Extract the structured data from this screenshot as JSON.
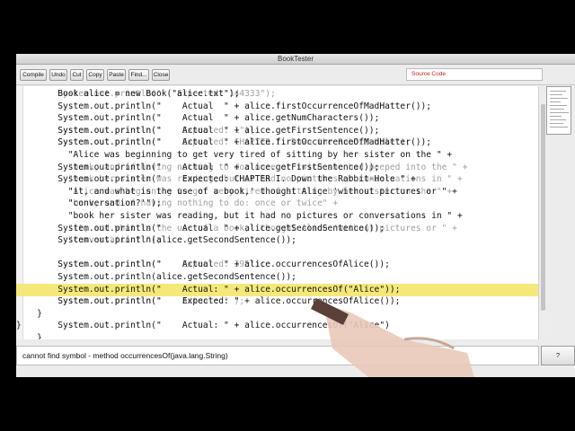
{
  "window": {
    "title": "BookTester"
  },
  "toolbar": {
    "buttons": [
      "Compile",
      "Undo",
      "Cut",
      "Copy",
      "Paste",
      "Find...",
      "Close"
    ],
    "view": "Source Code"
  },
  "code": {
    "lines": [
      {
        "text": "        Book alice = new Book(\"alice.txt\");",
        "ghost": "        System.out.println(\"   Expected: 144333\");"
      },
      {
        "text": "        System.out.println(\"    Actual  \" + alice.firstOccurrenceOfMadHatter());",
        "ghost": ""
      },
      {
        "text": "        System.out.println(\"    Actual  \" + alice.getNumCharacters());",
        "ghost": ""
      },
      {
        "text": "        System.out.println(\"    Actual  \" + alice.getFirstSentence());",
        "ghost": "        System.out.println(\"    Expected: 1\");"
      },
      {
        "text": "        System.out.println(\"    Actual  \" + alice.firstOccurrenceOfMadHatter());",
        "ghost": "        System.out.println(\"    Expected: CHAPTER I. Down the Rabbit-Hole\");"
      },
      {
        "text": "          \"Alice was beginning to get very tired of sitting by her sister on the \" +",
        "ghost": ""
      },
      {
        "text": "        System.out.println(\"    Actual  \" + alice.getFirstSentence());",
        "ghost": "          \"bank, and of having nothing to do: once or twice she had peeped into the \" +"
      },
      {
        "text": "        System.out.println(\"    Expected: CHAPTER I. Down the Rabbit-Hole \" +",
        "ghost": "          \"book her sister was reading, but it had no pictures or conversations in \" +"
      },
      {
        "text": "          \"it, and what is the use of a book,' thought Alice 'without pictures or \" +",
        "ghost": "          \"Alice was beginning to get very tired of sitting by her sister on the \" +"
      },
      {
        "text": "          \"conversation?'\");",
        "ghost": "          \"bank, and of having nothing to do: once or twice\" +"
      },
      {
        "text": "          \"book her sister was reading, but it had no pictures or conversations in \" +",
        "ghost": ""
      },
      {
        "text": "        System.out.println(\"    Actual  \" + alice.getSecondSentence());",
        "ghost": "          \"it, and what is the use of a book,' thought Alice 'without pictures or \" +"
      },
      {
        "text": "        System.out.println(alice.getSecondSentence());",
        "ghost": "          \"conversation?'\");"
      },
      {
        "text": "",
        "ghost": ""
      },
      {
        "text": "        System.out.println(\"    Actual  \" + alice.occurrencesOfAlice());",
        "ghost": "        System.out.println(\"    Expected: 395\");"
      },
      {
        "text": "        System.out.println(alice.getSecondSentence());",
        "ghost": ""
      },
      {
        "text": "        System.out.println(\"    Actual: \" + alice.occurrencesOf(\"Alice\"));",
        "ghost": ""
      },
      {
        "text": "        System.out.println(\"    Expected: \" + alice.occurrencesOfAlice());",
        "ghost": "        System.out.println(\"    Actual: \" );"
      },
      {
        "text": "    }",
        "ghost": ""
      },
      {
        "text": "}       System.out.println(\"    Actual: \" + alice.occurrencesOf(\"Alice\")",
        "ghost": ""
      },
      {
        "text": "    }",
        "ghost": ""
      }
    ]
  },
  "message": "cannot find symbol -   method occurrencesOf(java.lang.String)",
  "message_button": "?",
  "colors": {
    "highlight": "#f5e87a",
    "error": "#dc3c3c"
  }
}
